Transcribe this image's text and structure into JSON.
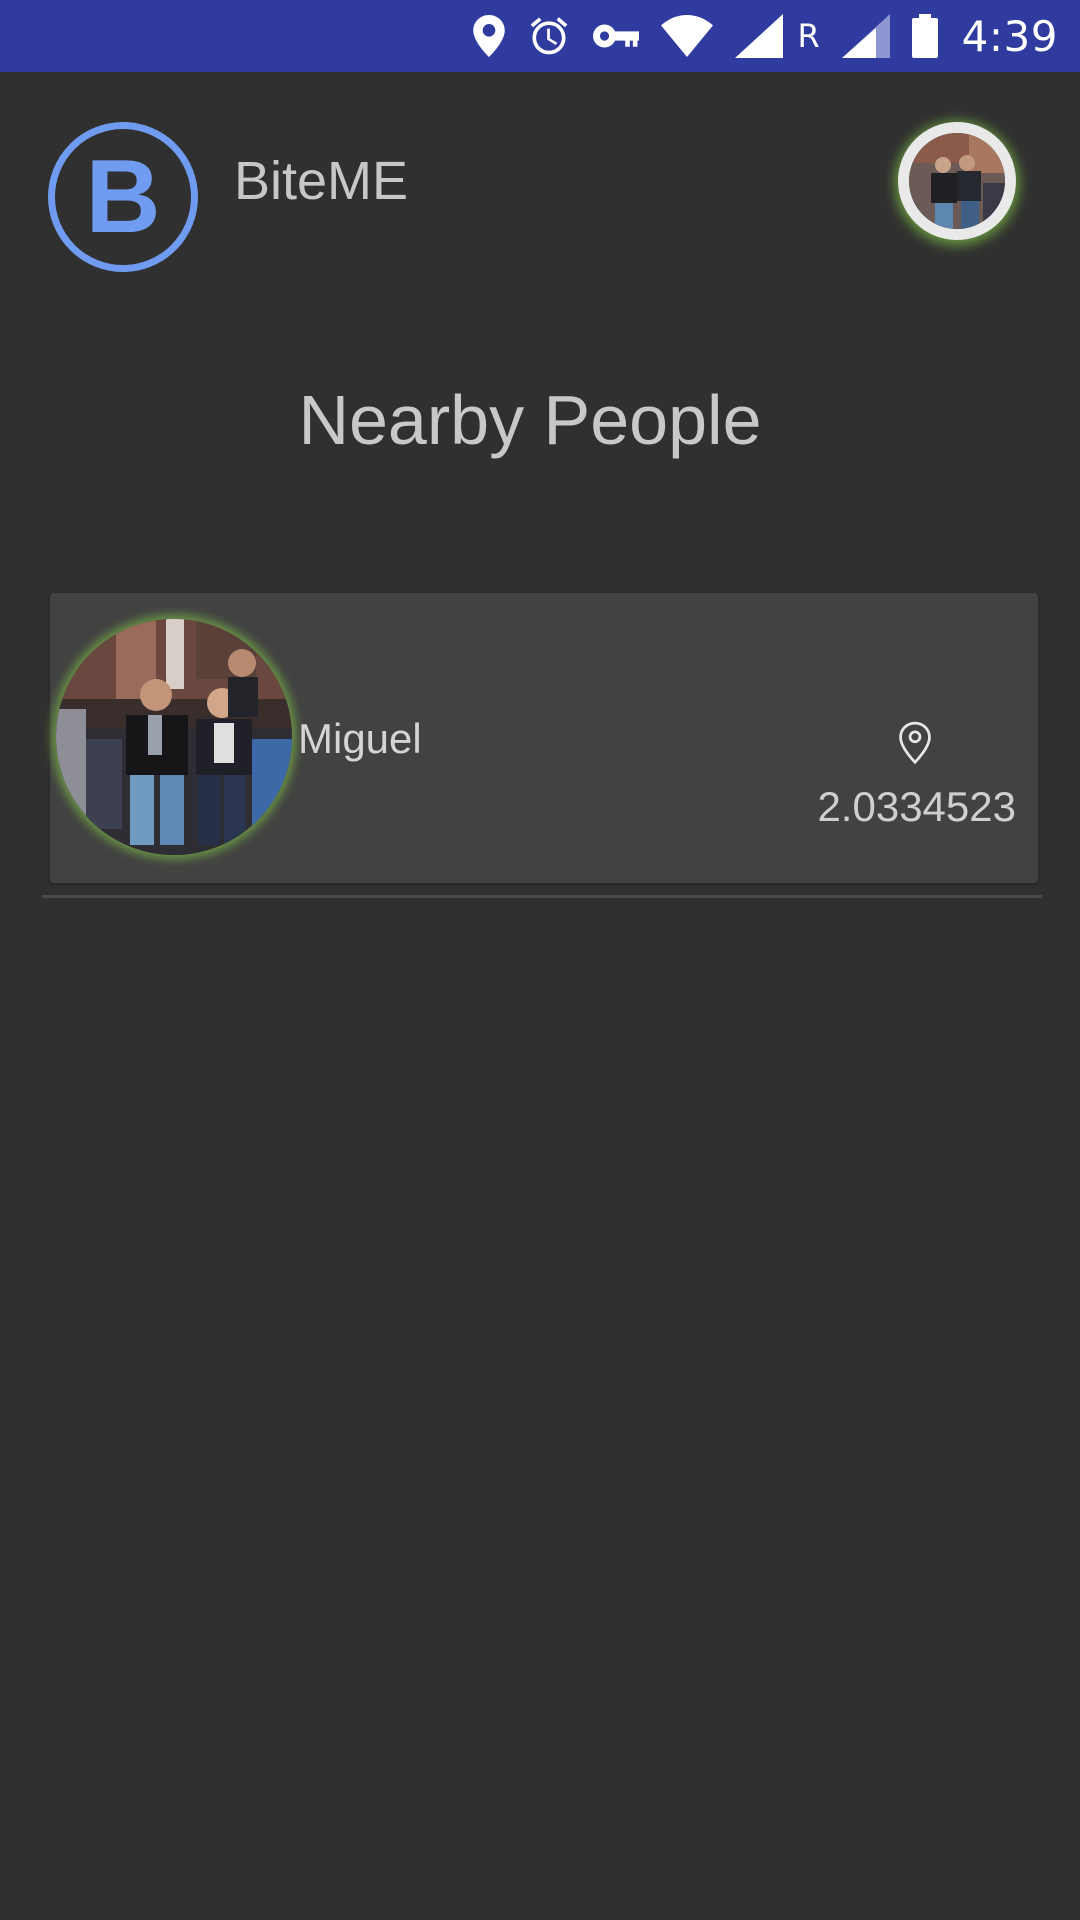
{
  "status_bar": {
    "time": "4:39",
    "roaming_indicator": "R",
    "icons": [
      "location-icon",
      "alarm-icon",
      "vpn-key-icon",
      "wifi-icon",
      "cell-signal-icon",
      "cell-signal-roaming-icon",
      "battery-icon"
    ]
  },
  "header": {
    "logo_letter": "B",
    "app_name": "BiteME",
    "profile_avatar": "user-photo"
  },
  "page": {
    "title": "Nearby People"
  },
  "people": [
    {
      "name": "Miguel",
      "distance": "2.0334523",
      "avatar": "person-photo",
      "distance_icon": "location-pin-icon"
    }
  ],
  "colors": {
    "status_bar": "#2f3b9e",
    "background": "#303030",
    "card": "#424242",
    "accent_logo": "#6f9cf0",
    "avatar_glow": "#7dbe46"
  }
}
